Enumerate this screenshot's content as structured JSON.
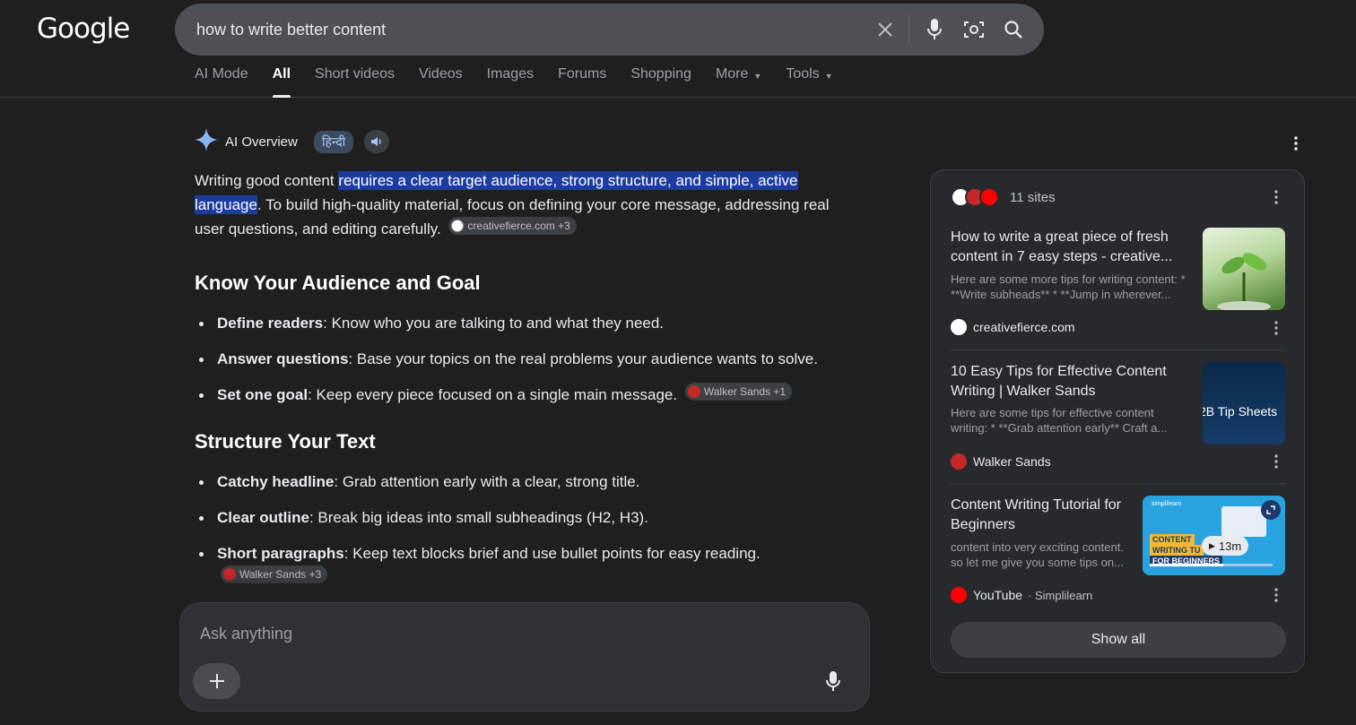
{
  "header": {
    "logo": "Google",
    "search": {
      "query": "how to write better content"
    },
    "tabs": [
      {
        "label": "AI Mode"
      },
      {
        "label": "All"
      },
      {
        "label": "Short videos"
      },
      {
        "label": "Videos"
      },
      {
        "label": "Images"
      },
      {
        "label": "Forums"
      },
      {
        "label": "Shopping"
      },
      {
        "label": "More"
      },
      {
        "label": "Tools"
      }
    ]
  },
  "overview": {
    "title": "AI Overview",
    "lang_chip": "हिन्दी",
    "intro_pre": "Writing good content",
    "intro_highlight": "requires a clear target audience, strong structure, and simple, active language",
    "intro_post": ". To build high-quality material, focus on defining your core message, addressing real user questions, and editing carefully.",
    "intro_cite": "creativefierce.com +3",
    "sections": [
      {
        "heading": "Know Your Audience and Goal",
        "items": [
          {
            "bold": "Define readers",
            "text": ": Know who you are talking to and what they need."
          },
          {
            "bold": "Answer questions",
            "text": ": Base your topics on the real problems your audience wants to solve."
          },
          {
            "bold": "Set one goal",
            "text": ": Keep every piece focused on a single main message.",
            "cite": "Walker Sands +1"
          }
        ]
      },
      {
        "heading": "Structure Your Text",
        "items": [
          {
            "bold": "Catchy headline",
            "text": ": Grab attention early with a clear, strong title."
          },
          {
            "bold": "Clear outline",
            "text": ": Break big ideas into small subheadings (H2, H3)."
          },
          {
            "bold": "Short paragraphs",
            "text": ": Keep text blocks brief and use bullet points for easy reading.",
            "cite": "Walker Sands +3"
          }
        ]
      }
    ]
  },
  "ask": {
    "placeholder": "Ask anything"
  },
  "sources": {
    "count_label": "11 sites",
    "cards": [
      {
        "title": "How to write a great piece of fresh content in 7 easy steps - creative...",
        "snippet": "Here are some more tips for writing content: * **Write subheads** * **Jump in wherever...",
        "source": "creativefierce.com",
        "sub": ""
      },
      {
        "title": "10 Easy Tips for Effective Content Writing | Walker Sands",
        "snippet": "Here are some tips for effective content writing: * **Grab attention early** Craft a...",
        "source": "Walker Sands",
        "sub": "",
        "thumb_text": "2B Tip Sheets"
      },
      {
        "title": "Content Writing Tutorial for Beginners",
        "snippet": "content into very exciting content. so let me give you some tips on...",
        "source": "YouTube",
        "sub": "· Simplilearn",
        "thumb_brand": "simplilearn",
        "thumb_line1": "CONTENT",
        "thumb_line2": "WRITING TU",
        "thumb_line3": "FOR BEGINNERS",
        "duration": "13m"
      }
    ],
    "show_all": "Show all"
  },
  "colors": {
    "background": "#1f1f1f",
    "highlight": "#1d3d9e",
    "panel": "#28292c"
  }
}
